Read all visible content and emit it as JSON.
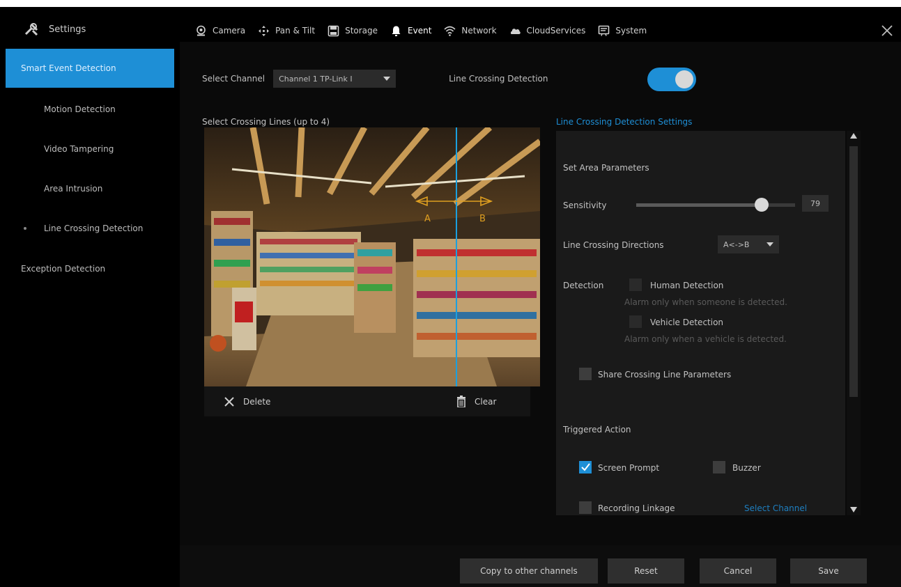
{
  "app": {
    "title": "Settings"
  },
  "tabs": [
    {
      "label": "Camera"
    },
    {
      "label": "Pan & Tilt"
    },
    {
      "label": "Storage"
    },
    {
      "label": "Event",
      "active": true
    },
    {
      "label": "Network"
    },
    {
      "label": "CloudServices"
    },
    {
      "label": "System"
    }
  ],
  "sidebar": {
    "items": [
      {
        "label": "Smart Event Detection",
        "active": true
      },
      {
        "label": "Motion Detection"
      },
      {
        "label": "Video Tampering"
      },
      {
        "label": "Area Intrusion"
      },
      {
        "label": "Line Crossing Detection",
        "current": true
      },
      {
        "label": "Exception Detection"
      }
    ]
  },
  "channel": {
    "label": "Select Channel",
    "value": "Channel 1 TP-Link I"
  },
  "feature": {
    "label": "Line Crossing Detection",
    "enabled": true
  },
  "preview": {
    "title": "Select Crossing Lines (up to 4)",
    "marker_a": "A",
    "marker_b": "B",
    "delete_label": "Delete",
    "clear_label": "Clear"
  },
  "settings": {
    "title": "Line Crossing Detection Settings",
    "area_params": "Set Area Parameters",
    "sensitivity_label": "Sensitivity",
    "sensitivity_value": "79",
    "sensitivity_fraction": 0.79,
    "direction_label": "Line Crossing Directions",
    "direction_value": "A<->B",
    "detection_label": "Detection",
    "human_label": "Human Detection",
    "human_desc": "Alarm only when someone is detected.",
    "vehicle_label": "Vehicle Detection",
    "vehicle_desc": "Alarm only when a vehicle is detected.",
    "share_label": "Share Crossing Line Parameters",
    "triggered_label": "Triggered Action",
    "screen_prompt_label": "Screen Prompt",
    "screen_prompt_checked": true,
    "buzzer_label": "Buzzer",
    "recording_label": "Recording Linkage",
    "select_channel_link": "Select Channel"
  },
  "footer": {
    "copy_label": "Copy to other channels",
    "reset_label": "Reset",
    "cancel_label": "Cancel",
    "save_label": "Save"
  },
  "colors": {
    "accent": "#1e8fd6",
    "line_marker": "#e0a020"
  }
}
